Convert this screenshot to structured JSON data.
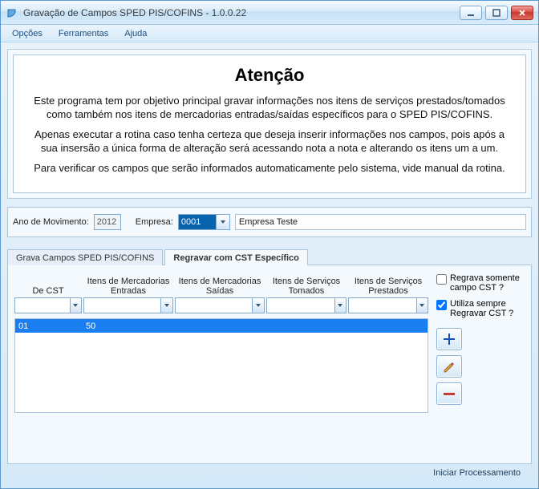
{
  "window": {
    "title": "Gravação de Campos SPED PIS/COFINS - 1.0.0.22"
  },
  "menu": {
    "opcoes": "Opções",
    "ferramentas": "Ferramentas",
    "ajuda": "Ajuda"
  },
  "warning": {
    "heading": "Atenção",
    "p1": "Este programa tem por objetivo principal gravar informações nos itens de serviços prestados/tomados como também nos itens de mercadorias entradas/saídas específicos para o SPED PIS/COFINS.",
    "p2": "Apenas executar a rotina caso tenha certeza que deseja inserir informações nos campos, pois após a sua insersão a única forma de alteração será acessando nota a nota e alterando os itens um a um.",
    "p3": "Para verificar os campos que serão informados automaticamente pelo sistema, vide manual da rotina."
  },
  "filters": {
    "ano_label": "Ano de Movimento:",
    "ano_value": "2012",
    "empresa_label": "Empresa:",
    "empresa_code": "0001",
    "empresa_name": "Empresa Teste"
  },
  "tabs": {
    "grava": "Grava Campos SPED PIS/COFINS",
    "regravar": "Regravar com CST Específico"
  },
  "columns": {
    "de_cst": "De CST",
    "merc_ent_l1": "Itens de Mercadorias",
    "merc_ent_l2": "Entradas",
    "merc_sai_l1": "Itens de Mercadorias",
    "merc_sai_l2": "Saídas",
    "serv_tom_l1": "Itens de Serviços",
    "serv_tom_l2": "Tomados",
    "serv_pre_l1": "Itens de Serviços",
    "serv_pre_l2": "Prestados"
  },
  "options": {
    "regrava_somente": "Regrava somente campo CST ?",
    "utiliza_sempre": "Utiliza sempre Regravar CST ?"
  },
  "buttons": {
    "add": "add",
    "edit": "edit",
    "remove": "remove"
  },
  "grid": {
    "row1_col1": "01",
    "row1_col2": "50"
  },
  "footer": {
    "start": "Iniciar Processamento"
  },
  "checks": {
    "regrava_somente": false,
    "utiliza_sempre": true
  }
}
